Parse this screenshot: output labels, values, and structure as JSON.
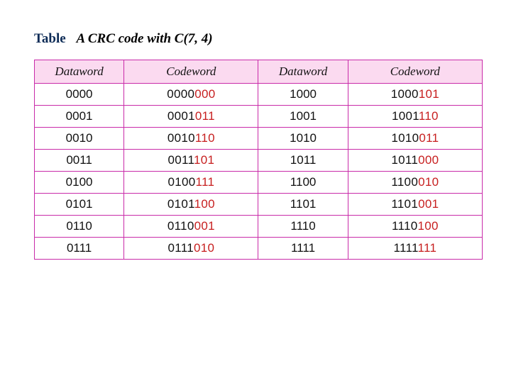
{
  "caption": {
    "label": "Table",
    "title": "A CRC code with C(7, 4)"
  },
  "headers": {
    "dw1": "Dataword",
    "cw1": "Codeword",
    "dw2": "Dataword",
    "cw2": "Codeword"
  },
  "rows": [
    {
      "dw1": "0000",
      "cw1_data": "0000",
      "cw1_crc": "000",
      "dw2": "1000",
      "cw2_data": "1000",
      "cw2_crc": "101"
    },
    {
      "dw1": "0001",
      "cw1_data": "0001",
      "cw1_crc": "011",
      "dw2": "1001",
      "cw2_data": "1001",
      "cw2_crc": "110"
    },
    {
      "dw1": "0010",
      "cw1_data": "0010",
      "cw1_crc": "110",
      "dw2": "1010",
      "cw2_data": "1010",
      "cw2_crc": "011"
    },
    {
      "dw1": "0011",
      "cw1_data": "0011",
      "cw1_crc": "101",
      "dw2": "1011",
      "cw2_data": "1011",
      "cw2_crc": "000"
    },
    {
      "dw1": "0100",
      "cw1_data": "0100",
      "cw1_crc": "111",
      "dw2": "1100",
      "cw2_data": "1100",
      "cw2_crc": "010"
    },
    {
      "dw1": "0101",
      "cw1_data": "0101",
      "cw1_crc": "100",
      "dw2": "1101",
      "cw2_data": "1101",
      "cw2_crc": "001"
    },
    {
      "dw1": "0110",
      "cw1_data": "0110",
      "cw1_crc": "001",
      "dw2": "1110",
      "cw2_data": "1110",
      "cw2_crc": "100"
    },
    {
      "dw1": "0111",
      "cw1_data": "0111",
      "cw1_crc": "010",
      "dw2": "1111",
      "cw2_data": "1111",
      "cw2_crc": "111"
    }
  ],
  "chart_data": {
    "type": "table",
    "title": "A CRC code with C(7, 4)",
    "columns": [
      "Dataword",
      "Codeword",
      "Dataword",
      "Codeword"
    ],
    "rows": [
      [
        "0000",
        "0000000",
        "1000",
        "1000101"
      ],
      [
        "0001",
        "0001011",
        "1001",
        "1001110"
      ],
      [
        "0010",
        "0010110",
        "1010",
        "1010011"
      ],
      [
        "0011",
        "0011101",
        "1011",
        "1011000"
      ],
      [
        "0100",
        "0100111",
        "1100",
        "1100010"
      ],
      [
        "0101",
        "0101100",
        "1101",
        "1101001"
      ],
      [
        "0110",
        "0110001",
        "1110",
        "1110100"
      ],
      [
        "0111",
        "0111010",
        "1111",
        "1111111"
      ]
    ]
  }
}
